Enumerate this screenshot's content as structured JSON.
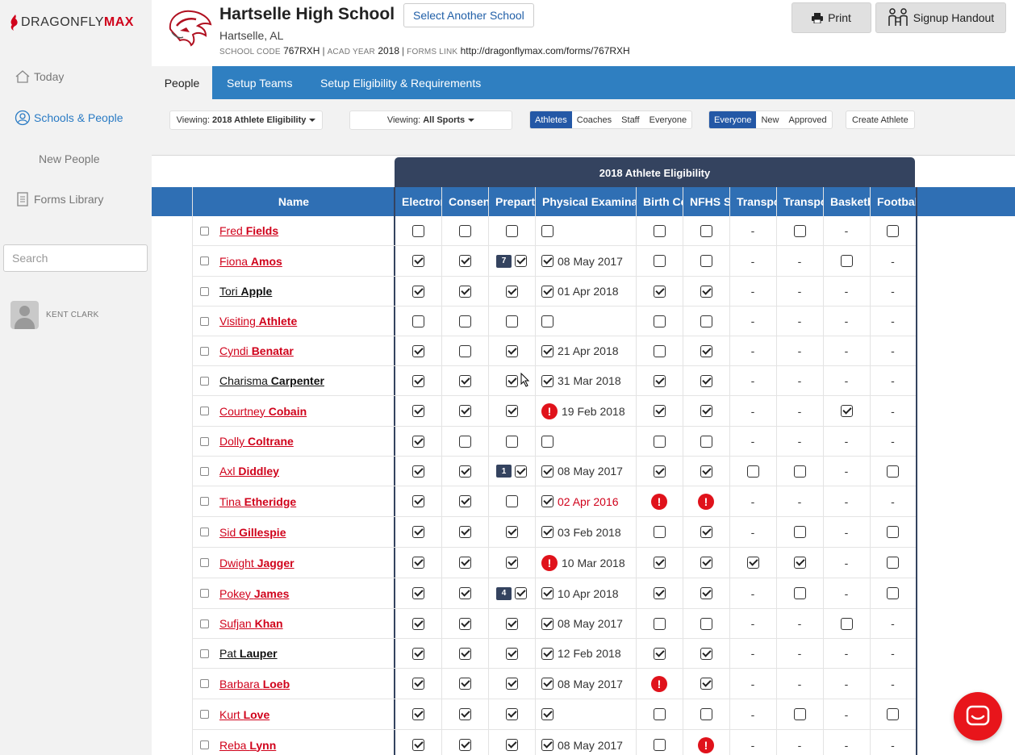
{
  "brand": {
    "logo_prefix": "DRAGONFLY",
    "logo_suffix": "MAX"
  },
  "sidebar": {
    "today": "Today",
    "schools_people": "Schools & People",
    "new_people": "New People",
    "forms_library": "Forms Library",
    "search_placeholder": "Search",
    "user_name": "KENT CLARK"
  },
  "header": {
    "school_name": "Hartselle High School",
    "select_school": "Select Another School",
    "location": "Hartselle, AL",
    "code_label": "SCHOOL CODE",
    "code": "767RXH",
    "year_label": "ACAD YEAR",
    "year": "2018",
    "forms_label": "FORMS LINK",
    "forms_link": "http://dragonflymax.com/forms/767RXH",
    "print": "Print",
    "signup": "Signup Handout"
  },
  "tabs": [
    "People",
    "Setup Teams",
    "Setup Eligibility & Requirements"
  ],
  "filters": {
    "viewing_label": "Viewing:",
    "viewing_eligibility": "2018 Athlete Eligibility",
    "viewing_sports": "All Sports",
    "role_seg": [
      "Athletes",
      "Coaches",
      "Staff",
      "Everyone"
    ],
    "status_seg": [
      "Everyone",
      "New",
      "Approved"
    ],
    "create": "Create Athlete"
  },
  "table": {
    "group_title": "2018 Athlete Eligibility",
    "columns": [
      "Name",
      "Electronic",
      "Consent",
      "Preparticipation",
      "Physical Examination",
      "Birth Certificate",
      "NFHS Sportsmanship",
      "Transportation",
      "Transportation",
      "Basketball",
      "Football"
    ],
    "rows": [
      {
        "first": "Fred",
        "last": "Fields",
        "color": "red",
        "cells": [
          "c0",
          "c0",
          "c0",
          [
            "c0",
            ""
          ],
          "c0",
          "c0",
          "-",
          "c0",
          "-",
          "c0"
        ]
      },
      {
        "first": "Fiona",
        "last": "Amos",
        "color": "red",
        "cells": [
          "c1",
          "c1",
          "n7",
          [
            "c1",
            "08 May 2017"
          ],
          "c0",
          "c0",
          "-",
          "-",
          "c0",
          "-"
        ]
      },
      {
        "first": "Tori",
        "last": "Apple",
        "color": "black",
        "cells": [
          "c1",
          "c1",
          "c1",
          [
            "c1",
            "01 Apr 2018"
          ],
          "c1",
          "c1",
          "-",
          "-",
          "-",
          "-"
        ]
      },
      {
        "first": "Visiting",
        "last": "Athlete",
        "color": "red",
        "cells": [
          "c0",
          "c0",
          "c0",
          [
            "c0",
            ""
          ],
          "c0",
          "c0",
          "-",
          "-",
          "-",
          "-"
        ]
      },
      {
        "first": "Cyndi",
        "last": "Benatar",
        "color": "red",
        "cells": [
          "c1",
          "c0",
          "c1",
          [
            "c1",
            "21 Apr 2018"
          ],
          "c0",
          "c1",
          "-",
          "-",
          "-",
          "-"
        ]
      },
      {
        "first": "Charisma",
        "last": "Carpenter",
        "color": "black",
        "cells": [
          "c1",
          "c1",
          "c1",
          [
            "c1",
            "31 Mar 2018"
          ],
          "c1",
          "c1",
          "-",
          "-",
          "-",
          "-"
        ]
      },
      {
        "first": "Courtney",
        "last": "Cobain",
        "color": "red",
        "cells": [
          "c1",
          "c1",
          "c1",
          [
            "a",
            "19 Feb 2018"
          ],
          "c1",
          "c1",
          "-",
          "-",
          "c1",
          "-"
        ]
      },
      {
        "first": "Dolly",
        "last": "Coltrane",
        "color": "red",
        "cells": [
          "c1",
          "c0",
          "c0",
          [
            "c0",
            ""
          ],
          "c0",
          "c0",
          "-",
          "-",
          "-",
          "-"
        ]
      },
      {
        "first": "Axl",
        "last": "Diddley",
        "color": "red",
        "cells": [
          "c1",
          "c1",
          "n1",
          [
            "c1",
            "08 May 2017"
          ],
          "c1",
          "c1",
          "c0",
          "c0",
          "-",
          "c0"
        ]
      },
      {
        "first": "Tina",
        "last": "Etheridge",
        "color": "red",
        "cells": [
          "c1",
          "c1",
          "c0",
          [
            "c1r",
            "02 Apr 2016"
          ],
          "a",
          "a",
          "-",
          "-",
          "-",
          "-"
        ]
      },
      {
        "first": "Sid",
        "last": "Gillespie",
        "color": "red",
        "cells": [
          "c1",
          "c1",
          "c1",
          [
            "c1",
            "03 Feb 2018"
          ],
          "c0",
          "c1",
          "-",
          "c0",
          "-",
          "c0"
        ]
      },
      {
        "first": "Dwight",
        "last": "Jagger",
        "color": "red",
        "cells": [
          "c1",
          "c1",
          "c1",
          [
            "a",
            "10 Mar 2018"
          ],
          "c1",
          "c1",
          "c1",
          "c1",
          "-",
          "c0"
        ]
      },
      {
        "first": "Pokey",
        "last": "James",
        "color": "red",
        "cells": [
          "c1",
          "c1",
          "n4",
          [
            "c1",
            "10 Apr 2018"
          ],
          "c1",
          "c1",
          "-",
          "c0",
          "-",
          "c0"
        ]
      },
      {
        "first": "Sufjan",
        "last": "Khan",
        "color": "red",
        "cells": [
          "c1",
          "c1",
          "c1",
          [
            "c1",
            "08 May 2017"
          ],
          "c0",
          "c0",
          "-",
          "-",
          "c0",
          "-"
        ]
      },
      {
        "first": "Pat",
        "last": "Lauper",
        "color": "black",
        "cells": [
          "c1",
          "c1",
          "c1",
          [
            "c1",
            "12 Feb 2018"
          ],
          "c1",
          "c1",
          "-",
          "-",
          "-",
          "-"
        ]
      },
      {
        "first": "Barbara",
        "last": "Loeb",
        "color": "red",
        "cells": [
          "c1",
          "c1",
          "c1",
          [
            "c1",
            "08 May 2017"
          ],
          "a",
          "c1",
          "-",
          "-",
          "-",
          "-"
        ]
      },
      {
        "first": "Kurt",
        "last": "Love",
        "color": "red",
        "cells": [
          "c1",
          "c1",
          "c1",
          [
            "c1",
            ""
          ],
          "c0",
          "c0",
          "-",
          "c0",
          "-",
          "c0"
        ]
      },
      {
        "first": "Reba",
        "last": "Lynn",
        "color": "red",
        "cells": [
          "c1",
          "c1",
          "c1",
          [
            "c1",
            "08 May 2017"
          ],
          "c0",
          "a",
          "-",
          "-",
          "-",
          "-"
        ]
      }
    ]
  },
  "colors": {
    "tab_blue": "#2f7fc1",
    "header_navy": "#34435f",
    "accent_red": "#d0021b"
  }
}
